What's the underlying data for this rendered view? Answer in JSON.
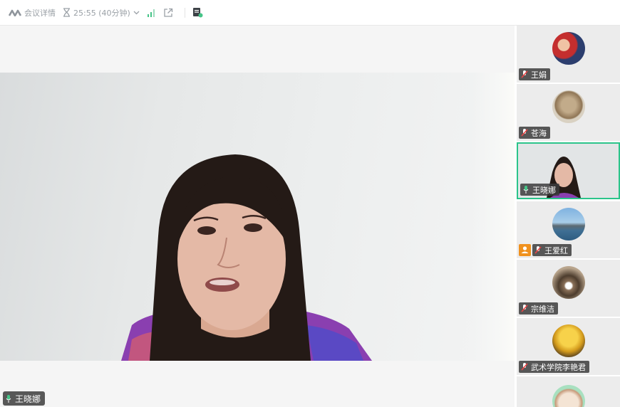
{
  "toolbar": {
    "meeting_details_label": "会议详情",
    "duration": "25:55 (40分钟)"
  },
  "main_speaker": {
    "name": "王晓娜"
  },
  "participants": [
    {
      "name": "王娟",
      "mic": "muted"
    },
    {
      "name": "苍海",
      "mic": "muted"
    },
    {
      "name": "王晓娜",
      "mic": "on",
      "active": true
    },
    {
      "name": "王爱红",
      "mic": "muted",
      "host": true
    },
    {
      "name": "宗维洁",
      "mic": "muted"
    },
    {
      "name": "武术学院李艳君",
      "mic": "muted"
    }
  ],
  "colors": {
    "active_border": "#2bc48a",
    "host_badge": "#f0911d",
    "signal_green": "#45c487"
  },
  "icons": [
    "meeting-logo-icon",
    "hourglass-icon",
    "chevron-down-icon",
    "signal-icon",
    "share-out-icon",
    "notes-icon",
    "mic-muted-icon",
    "mic-icon",
    "host-icon"
  ]
}
